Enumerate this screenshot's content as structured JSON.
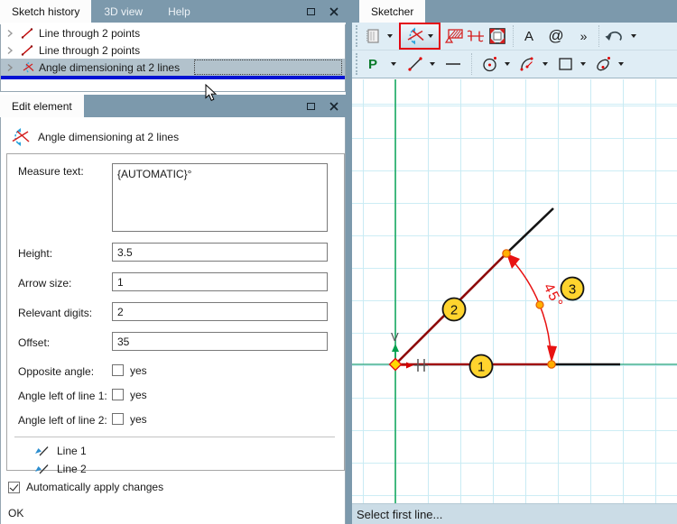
{
  "sketch_history_panel": {
    "tabs": [
      {
        "label": "Sketch history",
        "active": true
      },
      {
        "label": "3D view",
        "active": false
      },
      {
        "label": "Help",
        "active": false
      }
    ],
    "items": [
      {
        "label": "Line through 2 points",
        "selected": false
      },
      {
        "label": "Line through 2 points",
        "selected": false
      },
      {
        "label": "Angle dimensioning at 2 lines",
        "selected": true
      }
    ]
  },
  "edit_element_panel": {
    "tab": "Edit element",
    "element_title": "Angle dimensioning at 2 lines",
    "measure_text": {
      "label": "Measure text:",
      "value": "{AUTOMATIC}°"
    },
    "height": {
      "label": "Height:",
      "value": "3.5"
    },
    "arrow_size": {
      "label": "Arrow size:",
      "value": "1"
    },
    "relevant_digits": {
      "label": "Relevant digits:",
      "value": "2"
    },
    "offset": {
      "label": "Offset:",
      "value": "35"
    },
    "opposite_angle": {
      "label": "Opposite angle:",
      "option": "yes",
      "checked": false
    },
    "angle_left_line1": {
      "label": "Angle left of line 1:",
      "option": "yes",
      "checked": false
    },
    "angle_left_line2": {
      "label": "Angle left of line 2:",
      "option": "yes",
      "checked": false
    },
    "lines": [
      {
        "label": "Line 1"
      },
      {
        "label": "Line 2"
      }
    ],
    "auto_apply": {
      "label": "Automatically apply changes",
      "checked": true
    },
    "ok_label": "OK"
  },
  "sketcher_panel": {
    "tab": "Sketcher",
    "toolbar_icons": {
      "point_tool": "P",
      "text_tool": "A",
      "at_tool": "@",
      "overflow": "»"
    },
    "canvas": {
      "axis_label": "V",
      "angle_dimension_text": "45°",
      "badges": [
        "1",
        "2",
        "3"
      ]
    },
    "status": "Select first line..."
  },
  "colors": {
    "titlebar": "#7C99AC",
    "selection": "#B2C2CC",
    "drag_indicator_blue": "#0013D4",
    "toolbar_bg": "#DFEDF5",
    "active_tool_border": "#E30613",
    "status_bg": "#CBDCE6",
    "grid_line": "#C9EBF4",
    "axis_vertical_green": "#00A04D",
    "axis_horizontal_green": "#44B18D",
    "sketch_line_red": "#8E0A0A",
    "dimension_red": "#E81212",
    "badge_yellow": "#FFD42E",
    "handle_orange": "#FFB000"
  }
}
